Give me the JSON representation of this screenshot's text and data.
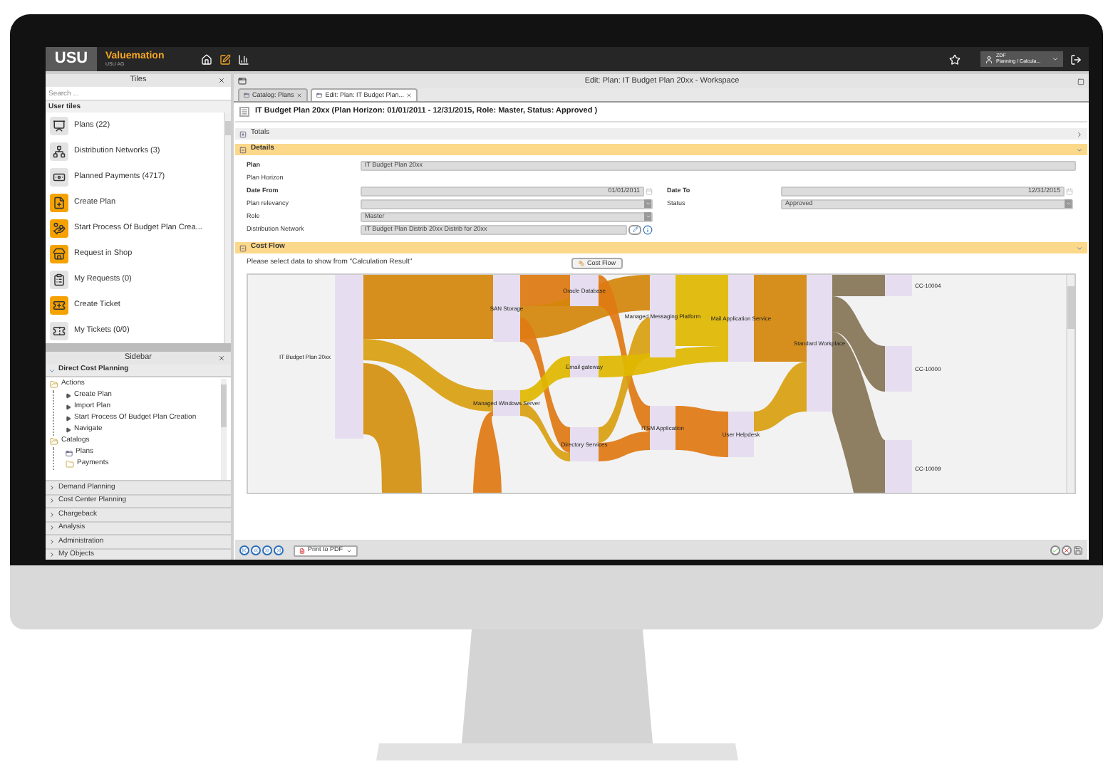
{
  "app_bar": {
    "logo": "USU",
    "product": "Valuemation",
    "company": "USU AG",
    "user_name": "ZDF",
    "user_role": "Planning / Calcula..."
  },
  "tiles": {
    "title": "Tiles",
    "search_placeholder": "Search ...",
    "section": "User tiles",
    "items": [
      {
        "label": "Plans (22)",
        "kind": "grey"
      },
      {
        "label": "Distribution Networks (3)",
        "kind": "grey"
      },
      {
        "label": "Planned Payments (4717)",
        "kind": "grey"
      },
      {
        "label": "Create Plan",
        "kind": "orange"
      },
      {
        "label": "Start Process Of Budget Plan Crea...",
        "kind": "orange"
      },
      {
        "label": "Request in Shop",
        "kind": "orange"
      },
      {
        "label": "My Requests (0)",
        "kind": "grey"
      },
      {
        "label": "Create Ticket",
        "kind": "orange"
      },
      {
        "label": "My Tickets (0/0)",
        "kind": "grey"
      }
    ]
  },
  "sidebar": {
    "title": "Sidebar",
    "open_section": "Direct Cost Planning",
    "tree": [
      {
        "label": "Actions",
        "kind": "folder",
        "expanded": true,
        "children": [
          {
            "label": "Create Plan",
            "kind": "action"
          },
          {
            "label": "Import Plan",
            "kind": "action"
          },
          {
            "label": "Start Process Of Budget Plan Creation",
            "kind": "action"
          },
          {
            "label": "Navigate",
            "kind": "action"
          }
        ]
      },
      {
        "label": "Catalogs",
        "kind": "folder",
        "expanded": true,
        "children": [
          {
            "label": "Plans",
            "kind": "catalog"
          },
          {
            "label": "Payments",
            "kind": "folder",
            "expanded": false
          }
        ]
      }
    ],
    "sections": [
      "Demand Planning",
      "Cost Center Planning",
      "Chargeback",
      "Analysis",
      "Administration",
      "My Objects"
    ]
  },
  "workspace": {
    "title": "Edit: Plan: IT Budget Plan 20xx - Workspace",
    "tabs": [
      {
        "label": "Catalog: Plans",
        "selected": false
      },
      {
        "label": "Edit: Plan: IT Budget Plan...",
        "selected": true
      }
    ],
    "header": "IT Budget Plan 20xx (Plan Horizon: 01/01/2011 - 12/31/2015, Role: Master, Status: Approved )",
    "totals": {
      "label": "Totals",
      "expanded": false
    },
    "details": {
      "label": "Details",
      "expanded": true,
      "rows": [
        {
          "cells": [
            {
              "label": "Plan",
              "bold": true,
              "kind": "wide_text",
              "value": "IT Budget Plan 20xx"
            }
          ]
        },
        {
          "cells": [
            {
              "label": "Plan Horizon",
              "bold": false,
              "kind": "none"
            }
          ]
        },
        {
          "cells": [
            {
              "label": "Date From",
              "bold": true,
              "kind": "date",
              "value": "01/01/2011"
            },
            {
              "label": "Date To",
              "bold": true,
              "kind": "date",
              "value": "12/31/2015"
            }
          ]
        },
        {
          "cells": [
            {
              "label": "Plan relevancy",
              "bold": false,
              "kind": "select"
            },
            {
              "label": "Status",
              "bold": false,
              "kind": "select",
              "value": "Approved"
            }
          ]
        },
        {
          "cells": [
            {
              "label": "Role",
              "bold": false,
              "kind": "select",
              "value": "Master"
            }
          ]
        },
        {
          "cells": [
            {
              "label": "Distribution Network",
              "bold": false,
              "kind": "lookup",
              "value": "IT Budget Plan Distrib 20xx Distrib for 20xx"
            }
          ]
        }
      ]
    },
    "cost_flow": {
      "label": "Cost Flow",
      "expanded": true,
      "prompt": "Please select data to show from \"Calculation Result\"",
      "button": "Cost Flow",
      "nodes": [
        {
          "label": "IT Budget Plan 20xx"
        },
        {
          "label": "SAN Storage"
        },
        {
          "label": "Oracle Database"
        },
        {
          "label": "Email gateway"
        },
        {
          "label": "Managed Windows Server"
        },
        {
          "label": "Directory Services"
        },
        {
          "label": "Managed Messaging Platform"
        },
        {
          "label": "ITSM Application"
        },
        {
          "label": "Mail Application Service"
        },
        {
          "label": "User Helpdesk"
        },
        {
          "label": "Standard Workplace"
        },
        {
          "label": "CC-10004"
        },
        {
          "label": "CC-10000"
        },
        {
          "label": "CC-10009"
        }
      ]
    },
    "toolbar": {
      "print": "Print to PDF"
    }
  }
}
